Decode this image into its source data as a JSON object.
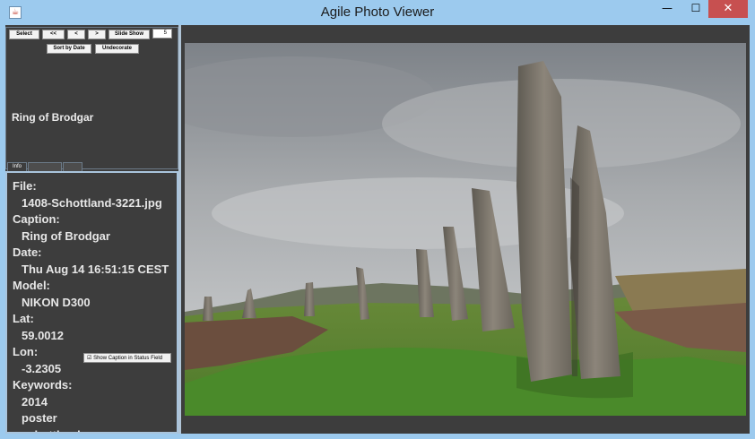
{
  "window": {
    "title": "Agile Photo Viewer",
    "app_icon_glyph": "☕",
    "minimize_glyph": "—",
    "maximize_glyph": "☐",
    "close_glyph": "✕"
  },
  "toolbar": {
    "select": "Select",
    "first": "<<",
    "prev": "<",
    "next": ">",
    "slideshow": "Slide Show",
    "interval": "5",
    "sort_by_date": "Sort by Date",
    "undecorate": "Undecorate"
  },
  "caption_heading": "Ring of Brodgar",
  "tabs": [
    {
      "label": "Info"
    },
    {
      "label": ""
    },
    {
      "label": ""
    }
  ],
  "info": {
    "file_label": "File:",
    "file_value": "1408-Schottland-3221.jpg",
    "caption_label": "Caption:",
    "caption_value": "Ring of Brodgar",
    "date_label": "Date:",
    "date_value": "Thu Aug 14 16:51:15 CEST",
    "model_label": "Model:",
    "model_value": "NIKON D300",
    "lat_label": "Lat:",
    "lat_value": "59.0012",
    "lon_label": "Lon:",
    "lon_value": "-3.2305",
    "keywords_label": "Keywords:",
    "keywords": [
      "2014",
      "poster",
      "schottland"
    ]
  },
  "show_caption_checkbox": {
    "label": "Show Caption in Status Field",
    "checked": true,
    "check_glyph": "☑"
  },
  "colors": {
    "title_bar": "#9ccaee",
    "panel_bg": "#3d3d3d",
    "close_button": "#c75050"
  }
}
